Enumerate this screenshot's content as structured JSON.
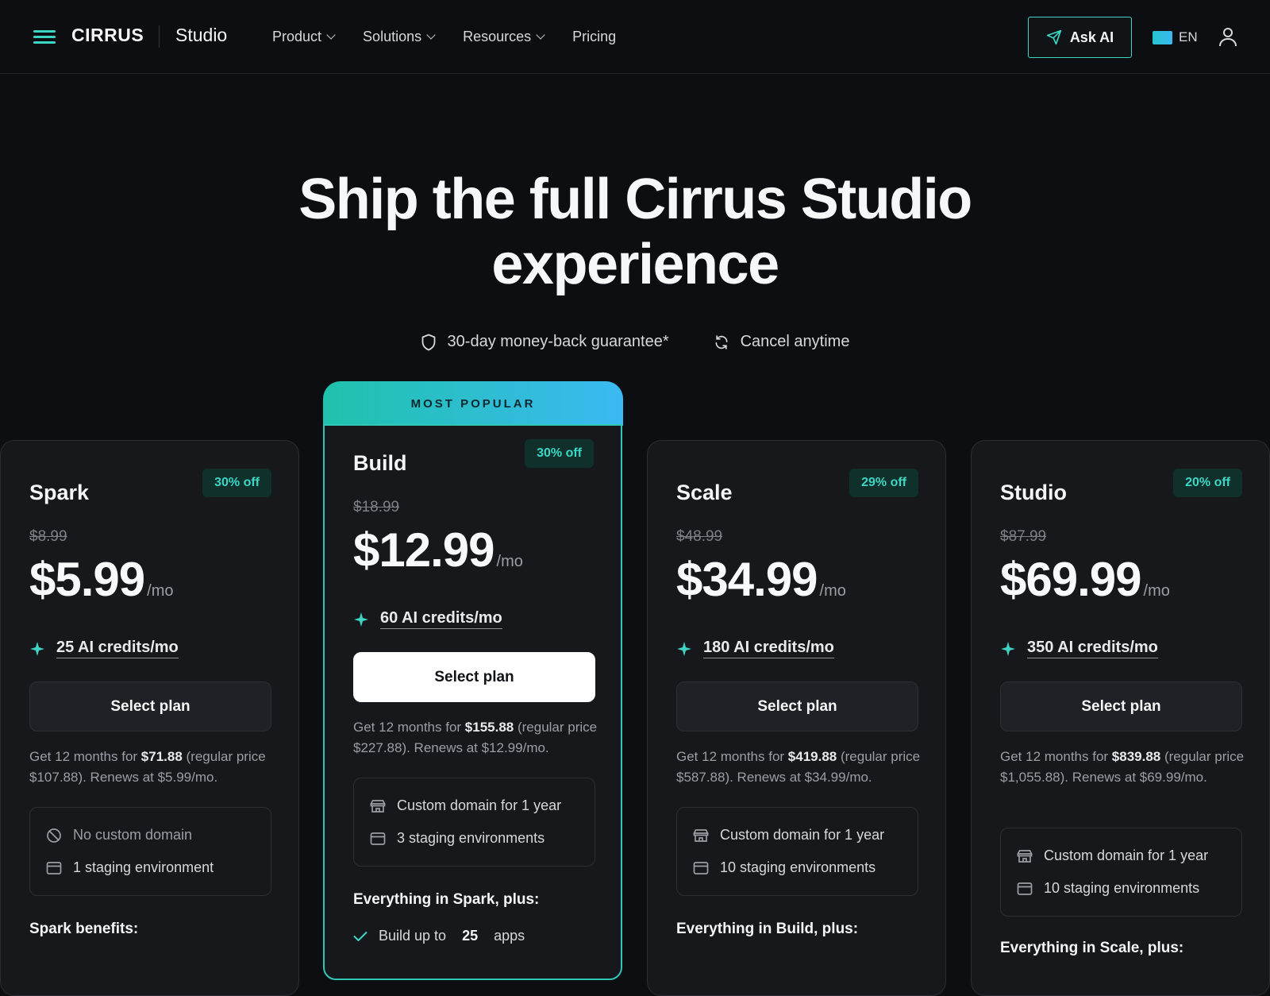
{
  "nav": {
    "brand": "CIRRUS",
    "product_name": "Studio",
    "links": [
      {
        "label": "Product",
        "has_dropdown": true
      },
      {
        "label": "Solutions",
        "has_dropdown": true
      },
      {
        "label": "Resources",
        "has_dropdown": true
      },
      {
        "label": "Pricing",
        "has_dropdown": false
      }
    ],
    "ask_ai_label": "Ask AI",
    "language": "EN"
  },
  "hero": {
    "title_line1": "Ship the full Cirrus Studio",
    "title_line2": "experience",
    "guarantee": "30-day money-back guarantee*",
    "cancel": "Cancel anytime"
  },
  "popular_label": "MOST POPULAR",
  "colors": {
    "accent": "#3dd6c4",
    "background": "#0d0e11",
    "card": "#16181c",
    "popular_gradient_start": "#1fc2ac",
    "popular_gradient_end": "#3bb9f2"
  },
  "plans": [
    {
      "name": "Spark",
      "discount": "30% off",
      "old_price": "$8.99",
      "price": "$5.99",
      "per": "/mo",
      "credits": "25 AI credits/mo",
      "cta": "Select plan",
      "terms_prefix": "Get 12 months for ",
      "terms_total": "$71.88",
      "terms_suffix": " (regular price $107.88). Renews at $5.99/mo.",
      "features": [
        {
          "icon": "no-domain-icon",
          "text": "No custom domain",
          "muted": true
        },
        {
          "icon": "staging-icon",
          "text": "1 staging environment",
          "muted": false
        }
      ],
      "section_heading": "Spark benefits:"
    },
    {
      "name": "Build",
      "discount": "30% off",
      "old_price": "$18.99",
      "price": "$12.99",
      "per": "/mo",
      "credits": "60 AI credits/mo",
      "cta": "Select plan",
      "terms_prefix": "Get 12 months for ",
      "terms_total": "$155.88",
      "terms_suffix": " (regular price $227.88). Renews at $12.99/mo.",
      "features": [
        {
          "icon": "domain-icon",
          "text": "Custom domain for 1 year",
          "muted": false
        },
        {
          "icon": "staging-icon",
          "text": "3 staging environments",
          "muted": false
        }
      ],
      "section_heading": "Everything in Spark, plus:",
      "list": [
        {
          "prefix": "Build up to",
          "value": "25",
          "suffix": "apps"
        }
      ]
    },
    {
      "name": "Scale",
      "discount": "29% off",
      "old_price": "$48.99",
      "price": "$34.99",
      "per": "/mo",
      "credits": "180 AI credits/mo",
      "cta": "Select plan",
      "terms_prefix": "Get 12 months for ",
      "terms_total": "$419.88",
      "terms_suffix": " (regular price $587.88). Renews at $34.99/mo.",
      "features": [
        {
          "icon": "domain-icon",
          "text": "Custom domain for 1 year",
          "muted": false
        },
        {
          "icon": "staging-icon",
          "text": "10 staging environments",
          "muted": false
        }
      ],
      "section_heading": "Everything in Build, plus:"
    },
    {
      "name": "Studio",
      "discount": "20% off",
      "old_price": "$87.99",
      "price": "$69.99",
      "per": "/mo",
      "credits": "350 AI credits/mo",
      "cta": "Select plan",
      "terms_prefix": "Get 12 months for ",
      "terms_total": "$839.88",
      "terms_suffix": " (regular price $1,055.88). Renews at $69.99/mo.",
      "features": [
        {
          "icon": "domain-icon",
          "text": "Custom domain for 1 year",
          "muted": false
        },
        {
          "icon": "staging-icon",
          "text": "10 staging environments",
          "muted": false
        }
      ],
      "section_heading": "Everything in Scale, plus:"
    }
  ]
}
